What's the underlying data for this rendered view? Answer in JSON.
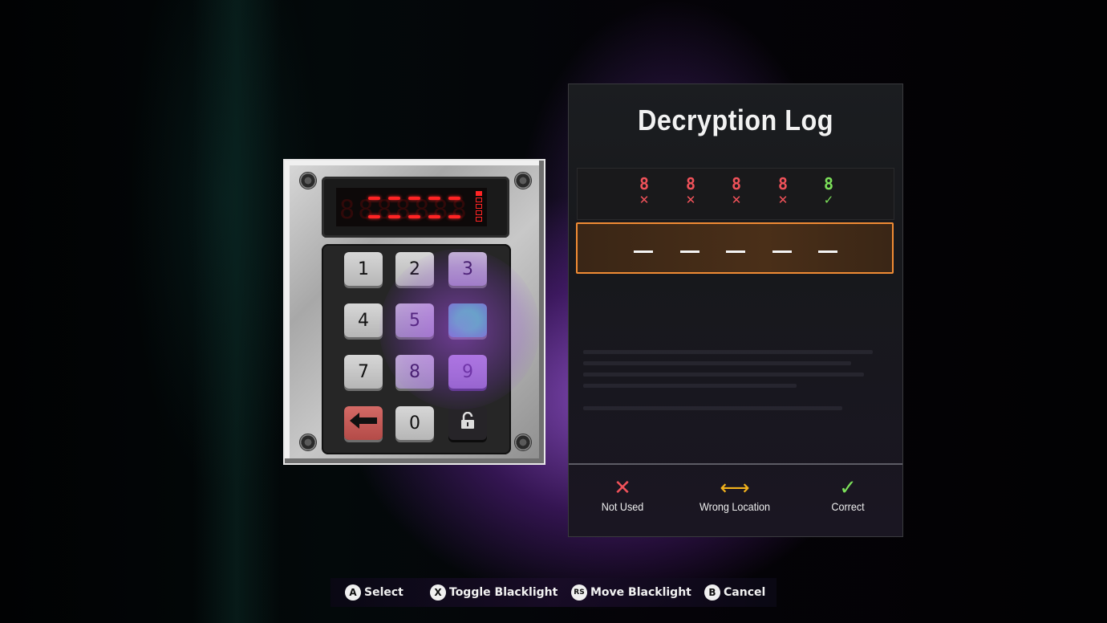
{
  "keypad": {
    "display": {
      "ghost_digits": "8888888",
      "entered_count": 0,
      "code_length": 5,
      "attempts_total": 5,
      "attempts_used": 1,
      "color": "#ff2424"
    },
    "keys": [
      {
        "label": "1",
        "kind": "digit",
        "state": "normal"
      },
      {
        "label": "2",
        "kind": "digit",
        "state": "normal"
      },
      {
        "label": "3",
        "kind": "digit",
        "state": "blacklit"
      },
      {
        "label": "4",
        "kind": "digit",
        "state": "normal"
      },
      {
        "label": "5",
        "kind": "digit",
        "state": "blacklit"
      },
      {
        "label": "",
        "kind": "digit",
        "state": "fingerprint"
      },
      {
        "label": "7",
        "kind": "digit",
        "state": "normal"
      },
      {
        "label": "8",
        "kind": "digit",
        "state": "blacklit"
      },
      {
        "label": "9",
        "kind": "digit",
        "state": "blacklit"
      },
      {
        "label": "←",
        "kind": "backspace",
        "state": "normal"
      },
      {
        "label": "0",
        "kind": "digit",
        "state": "normal"
      },
      {
        "label": "🔓",
        "kind": "submit",
        "state": "normal"
      }
    ]
  },
  "log": {
    "title": "Decryption Log",
    "previous_guess": [
      {
        "digit": "8",
        "result": "not_used",
        "mark": "✕"
      },
      {
        "digit": "8",
        "result": "not_used",
        "mark": "✕"
      },
      {
        "digit": "8",
        "result": "not_used",
        "mark": "✕"
      },
      {
        "digit": "8",
        "result": "not_used",
        "mark": "✕"
      },
      {
        "digit": "8",
        "result": "correct",
        "mark": "✓"
      }
    ],
    "current_input": [
      "",
      "",
      "",
      "",
      ""
    ],
    "legend": [
      {
        "icon": "✕",
        "label": "Not Used",
        "color": "#f0525a"
      },
      {
        "icon": "⟷",
        "label": "Wrong Location",
        "color": "#f2b21c"
      },
      {
        "icon": "✓",
        "label": "Correct",
        "color": "#7ce05a"
      }
    ],
    "accent_color": "#f08b34"
  },
  "prompts": [
    {
      "button": "A",
      "label": "Select"
    },
    {
      "button": "X",
      "label": "Toggle Blacklight"
    },
    {
      "button": "RS",
      "label": "Move Blacklight"
    },
    {
      "button": "B",
      "label": "Cancel"
    }
  ]
}
